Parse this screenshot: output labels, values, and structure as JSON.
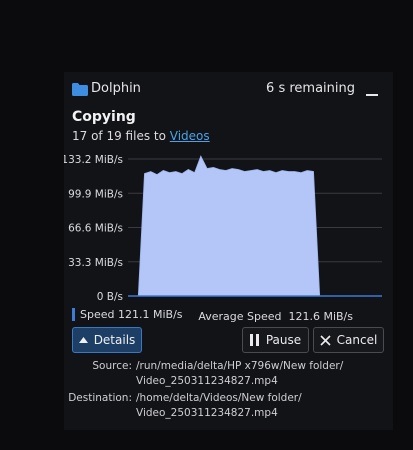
{
  "header": {
    "app_name": "Dolphin",
    "remaining": "6 s remaining",
    "folder_color": "#3d8de0"
  },
  "job": {
    "title": "Copying",
    "progress_prefix": "17 of 19 files to ",
    "destination_link": "Videos"
  },
  "chart_data": {
    "type": "area",
    "yticks": [
      "0 B/s",
      "33.3 MiB/s",
      "66.6 MiB/s",
      "99.9 MiB/s",
      "133.2 MiB/s"
    ],
    "ytick_values": [
      0,
      33.3,
      66.6,
      99.9,
      133.2
    ],
    "ylim": [
      0,
      133.2
    ],
    "grid": true,
    "series": [
      {
        "values": [
          0,
          0,
          119,
          121,
          118,
          122,
          120,
          121,
          119,
          123,
          120,
          136,
          124,
          125,
          123,
          122,
          124,
          123,
          121,
          122,
          123,
          121,
          122,
          120,
          122,
          121,
          121,
          120,
          122,
          121,
          0,
          0
        ],
        "color": "#b3c6f7"
      }
    ]
  },
  "stats": {
    "speed_label": "Speed",
    "speed_value": "121.1 MiB/s",
    "avg_label": "Average Speed",
    "avg_value": "121.6 MiB/s"
  },
  "buttons": {
    "details": "Details",
    "pause": "Pause",
    "cancel": "Cancel"
  },
  "details": {
    "source_label": "Source:",
    "source_line1": "/run/media/delta/HP x796w/New folder/",
    "source_line2": "Video_250311234827.mp4",
    "destination_label": "Destination:",
    "destination_line1": "/home/delta/Videos/New folder/",
    "destination_line2": "Video_250311234827.mp4"
  }
}
